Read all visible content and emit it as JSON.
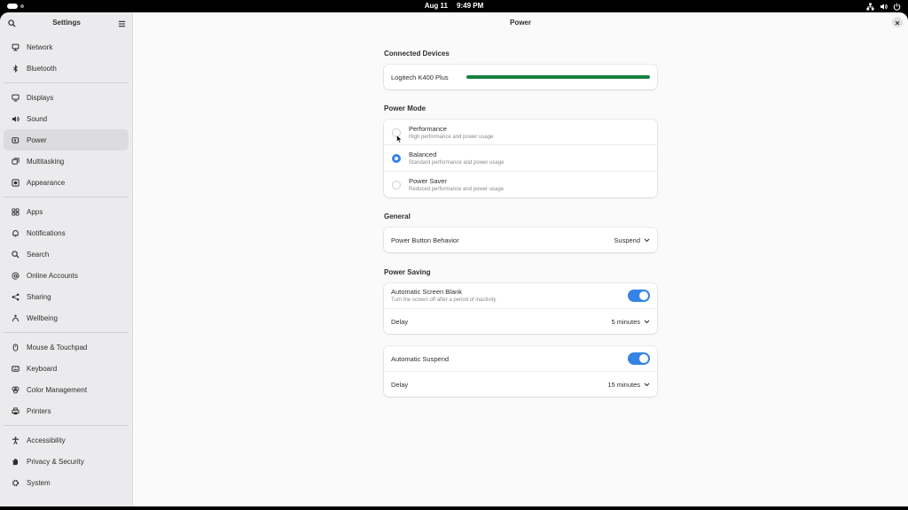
{
  "topbar": {
    "date": "Aug 11",
    "time": "9:49 PM"
  },
  "sidebar": {
    "title": "Settings",
    "items": [
      {
        "label": "Network",
        "icon": "network-icon"
      },
      {
        "label": "Bluetooth",
        "icon": "bluetooth-icon"
      },
      {
        "label": "Displays",
        "icon": "display-icon"
      },
      {
        "label": "Sound",
        "icon": "sound-icon"
      },
      {
        "label": "Power",
        "icon": "power-icon",
        "active": true
      },
      {
        "label": "Multitasking",
        "icon": "multitasking-icon"
      },
      {
        "label": "Appearance",
        "icon": "appearance-icon"
      },
      {
        "label": "Apps",
        "icon": "apps-icon"
      },
      {
        "label": "Notifications",
        "icon": "bell-icon"
      },
      {
        "label": "Search",
        "icon": "search-icon"
      },
      {
        "label": "Online Accounts",
        "icon": "at-icon"
      },
      {
        "label": "Sharing",
        "icon": "share-icon"
      },
      {
        "label": "Wellbeing",
        "icon": "wellbeing-icon"
      },
      {
        "label": "Mouse & Touchpad",
        "icon": "mouse-icon"
      },
      {
        "label": "Keyboard",
        "icon": "keyboard-icon"
      },
      {
        "label": "Color Management",
        "icon": "palette-icon"
      },
      {
        "label": "Printers",
        "icon": "printer-icon"
      },
      {
        "label": "Accessibility",
        "icon": "accessibility-icon"
      },
      {
        "label": "Privacy & Security",
        "icon": "hand-icon"
      },
      {
        "label": "System",
        "icon": "gear-icon"
      }
    ]
  },
  "main": {
    "title": "Power",
    "connected_devices": {
      "title": "Connected Devices",
      "device": "Logitech K400 Plus",
      "battery_level": 1.0,
      "battery_color": "#188141"
    },
    "power_mode": {
      "title": "Power Mode",
      "options": [
        {
          "label": "Performance",
          "sub": "High performance and power usage",
          "selected": false
        },
        {
          "label": "Balanced",
          "sub": "Standard performance and power usage",
          "selected": true
        },
        {
          "label": "Power Saver",
          "sub": "Reduced performance and power usage",
          "selected": false
        }
      ]
    },
    "general": {
      "title": "General",
      "power_button_label": "Power Button Behavior",
      "power_button_value": "Suspend"
    },
    "power_saving": {
      "title": "Power Saving",
      "screen_blank_label": "Automatic Screen Blank",
      "screen_blank_sub": "Turn the screen off after a period of inactivity",
      "screen_blank_on": true,
      "screen_blank_delay_label": "Delay",
      "screen_blank_delay_value": "5 minutes",
      "suspend_label": "Automatic Suspend",
      "suspend_on": true,
      "suspend_delay_label": "Delay",
      "suspend_delay_value": "15 minutes"
    }
  },
  "colors": {
    "accent": "#3584e4",
    "battery": "#188141"
  }
}
